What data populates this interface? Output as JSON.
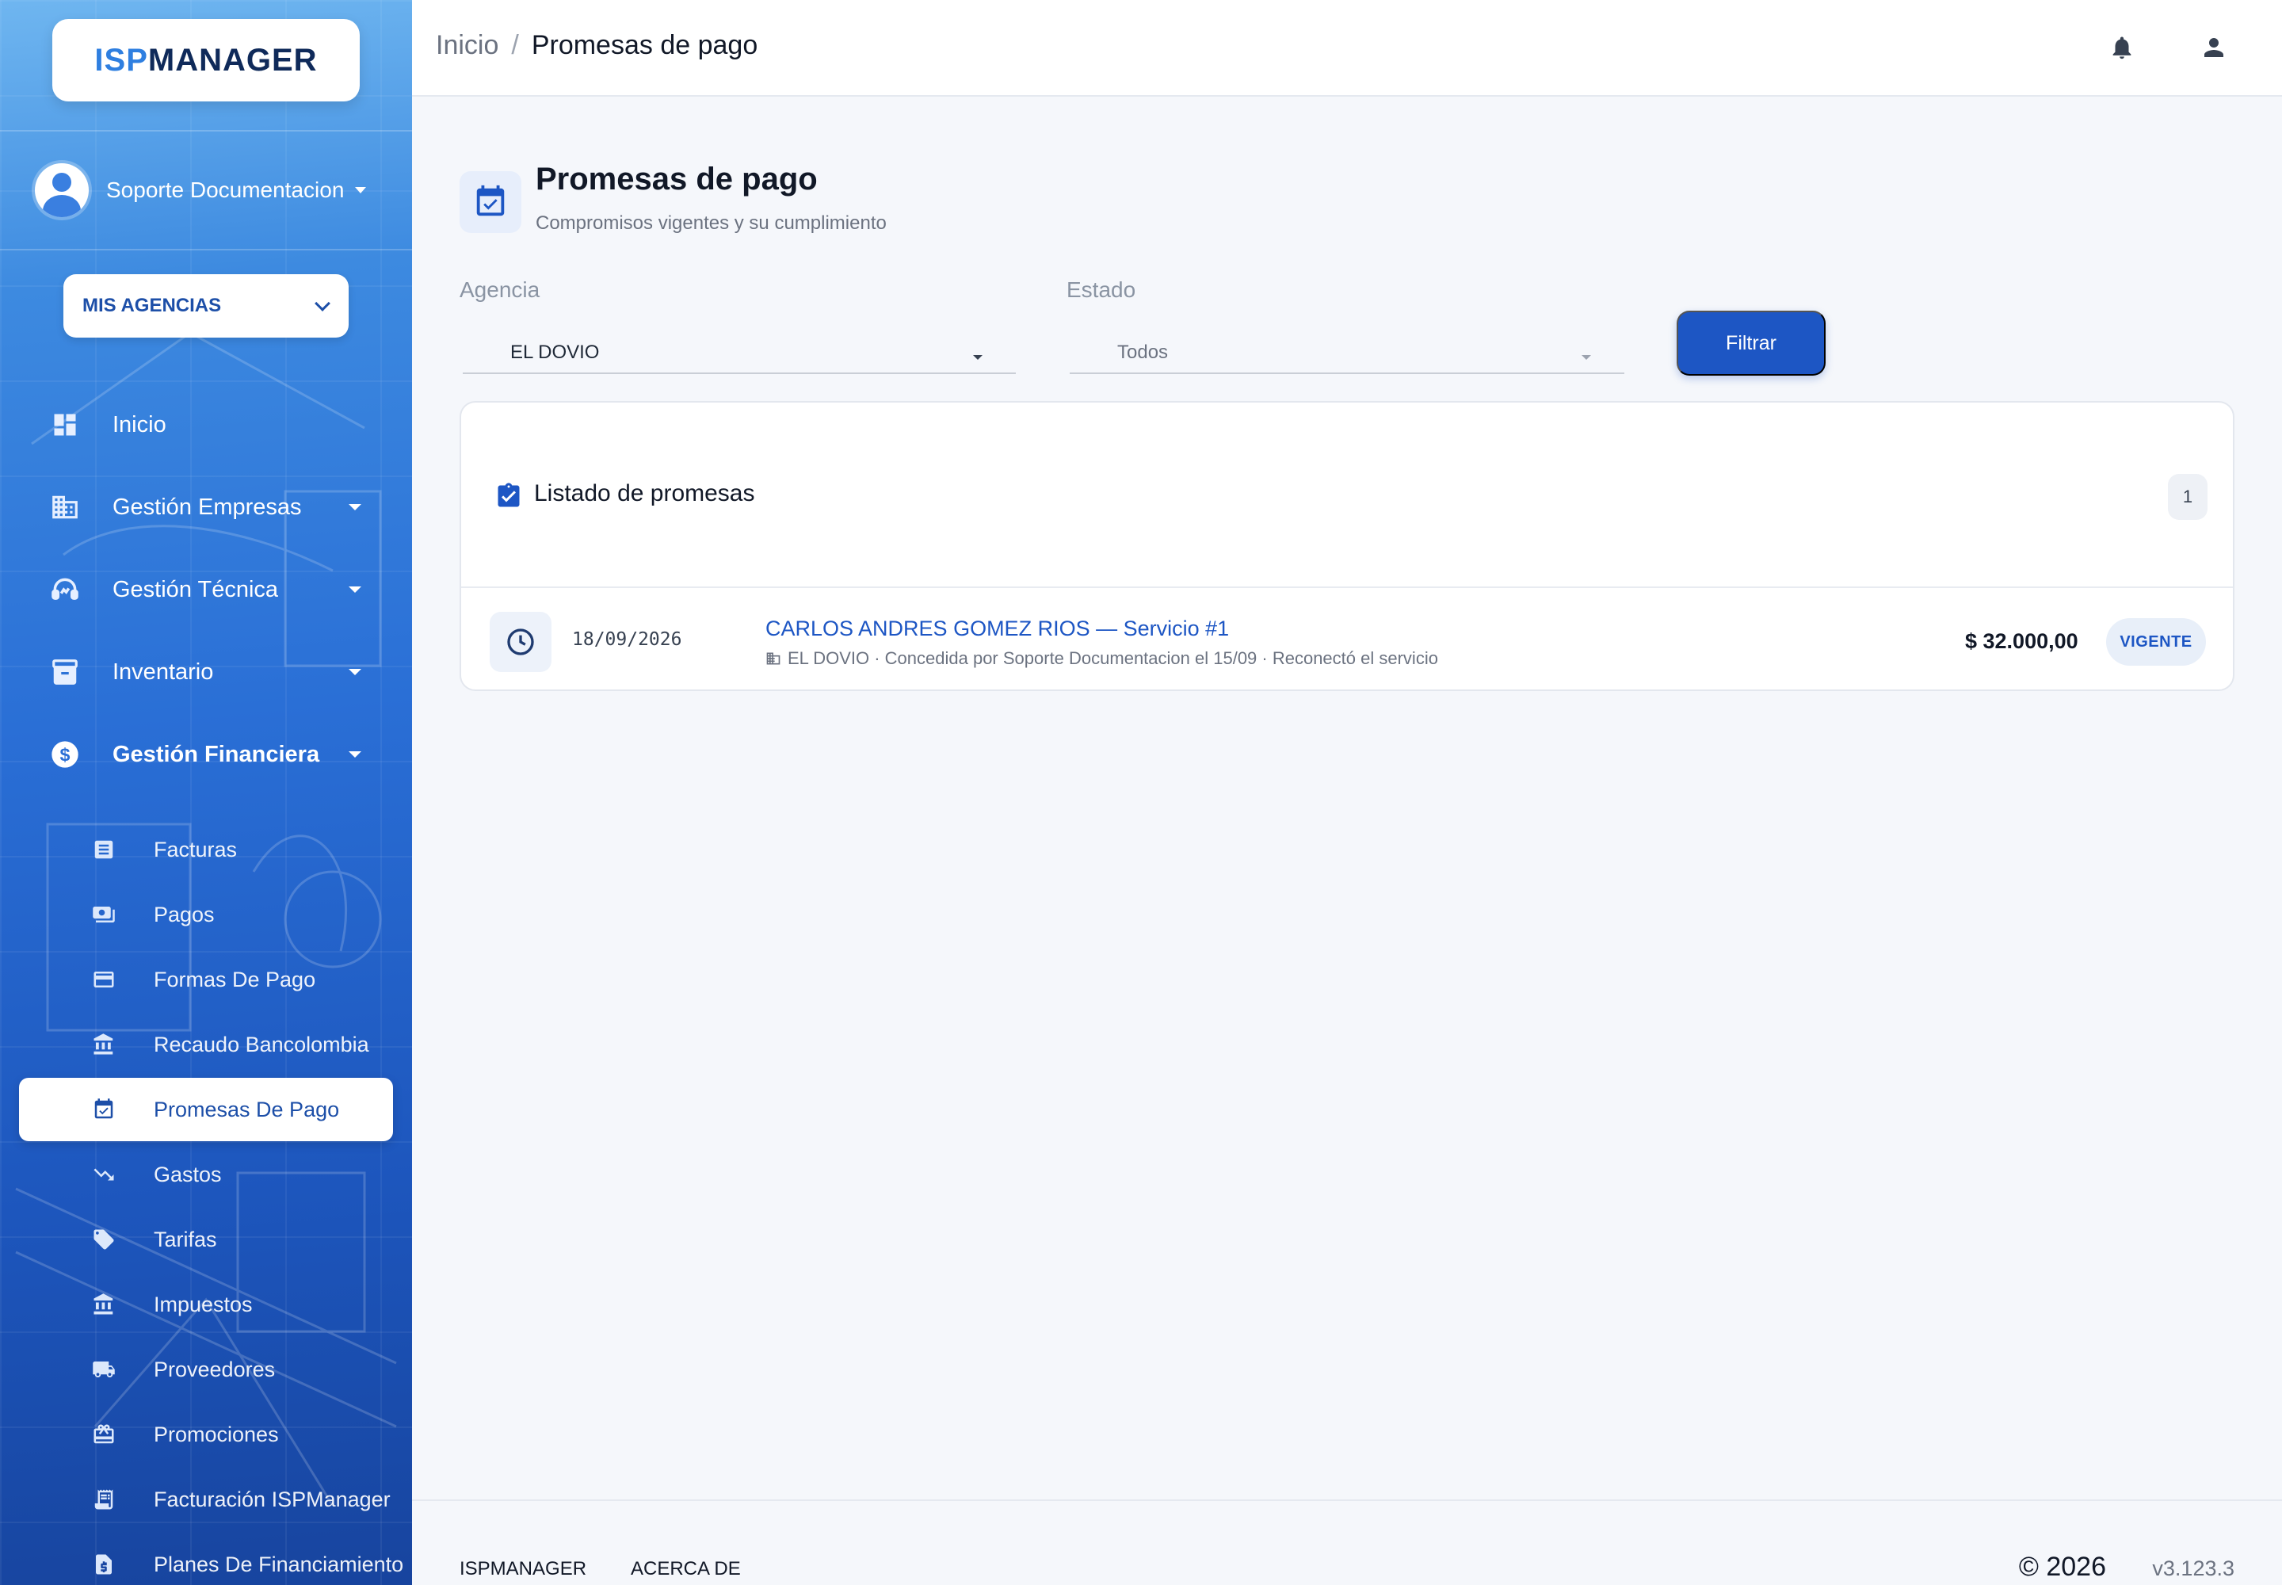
{
  "brand": {
    "logo_part1": "ISP",
    "logo_part2": "MANAGER",
    "accent": "#2f7fe0",
    "dark": "#0f2a5a"
  },
  "user": {
    "name": "Soporte Documentacion"
  },
  "agencias": {
    "label": "MIS AGENCIAS"
  },
  "nav": {
    "inicio": "Inicio",
    "empresas": "Gestión Empresas",
    "tecnica": "Gestión Técnica",
    "inventario": "Inventario",
    "financiera": "Gestión Financiera",
    "sub": [
      {
        "label": "Facturas",
        "icon": "receipt-icon"
      },
      {
        "label": "Pagos",
        "icon": "money-icon"
      },
      {
        "label": "Formas De Pago",
        "icon": "card-icon"
      },
      {
        "label": "Recaudo Bancolombia",
        "icon": "bank-icon"
      },
      {
        "label": "Promesas De Pago",
        "icon": "event-check-icon"
      },
      {
        "label": "Gastos",
        "icon": "trend-down-icon"
      },
      {
        "label": "Tarifas",
        "icon": "tag-icon"
      },
      {
        "label": "Impuestos",
        "icon": "bank-icon"
      },
      {
        "label": "Proveedores",
        "icon": "truck-icon"
      },
      {
        "label": "Promociones",
        "icon": "gift-icon"
      },
      {
        "label": "Facturación ISPManager",
        "icon": "invoice-icon"
      },
      {
        "label": "Planes De Financiamiento",
        "icon": "document-dollar-icon"
      }
    ]
  },
  "breadcrumb": {
    "home": "Inicio",
    "sep": "/",
    "current": "Promesas de pago"
  },
  "page": {
    "title": "Promesas de pago",
    "subtitle": "Compromisos vigentes y su cumplimiento"
  },
  "filters": {
    "agencia_label": "Agencia",
    "agencia_value": "EL DOVIO",
    "estado_label": "Estado",
    "estado_value": "Todos",
    "button": "Filtrar"
  },
  "list": {
    "title": "Listado de promesas",
    "count": "1",
    "items": [
      {
        "date": "18/09/2026",
        "client": "CARLOS ANDRES GOMEZ RIOS — Servicio #1",
        "meta": "EL DOVIO · Concedida por Soporte Documentacion el 15/09 · Reconectó el servicio",
        "amount": "$ 32.000,00",
        "status": "VIGENTE"
      }
    ]
  },
  "footer": {
    "link1": "ISPMANAGER",
    "link2": "ACERCA DE",
    "copyright": "© 2026",
    "version": "v3.123.3"
  }
}
